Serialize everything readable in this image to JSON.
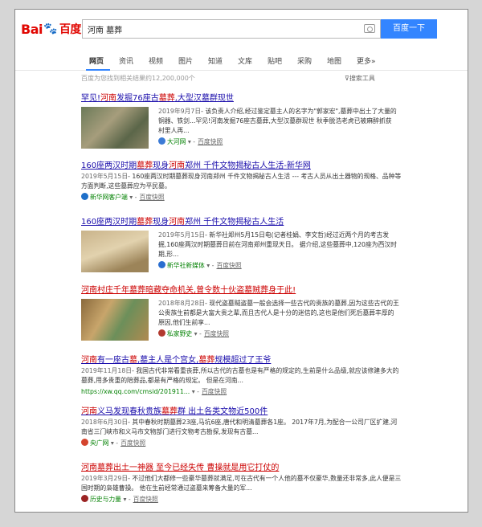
{
  "header": {
    "logo_text": {
      "bai": "Bai",
      "du": "du",
      "cn": "百度"
    },
    "search_value": "河南 墓葬",
    "search_button": "百度一下"
  },
  "tabs": [
    "网页",
    "资讯",
    "视频",
    "图片",
    "知道",
    "文库",
    "贴吧",
    "采购",
    "地图",
    "更多»"
  ],
  "stats": "百度为您找到相关结果约12,200,000个",
  "tools": "搜索工具",
  "results": [
    {
      "title_parts": [
        "罕见!",
        "河南",
        "发掘76座古",
        "墓葬",
        ",大型汉墓群现世"
      ],
      "date": "2019年9月7日",
      "body": "- 该负责人介绍,经过鉴定墓主人的名字为\"郭家宏\",墓葬中出土了大量的铜器、铁剑...罕见!河南发掘76座古墓葬,大型汉墓群现世 秋季脱浩老虎已被麻醉抓获 村里人再...",
      "source": "大河网",
      "kuaizhao": "百度快照"
    },
    {
      "title_parts": [
        "160座两汉时期",
        "墓葬",
        "现身",
        "河南",
        "郑州 千件文物揭秘古人生活-新华网"
      ],
      "date": "2019年5月15日",
      "body": "- 160座两汉时期墓葬现身河南郑州 千件文物揭秘古人生活 --- 考古人员从出土器物的规格、品种等方面判断,这些墓葬应为平民墓。",
      "source": "新华网客户端",
      "kuaizhao": "百度快照"
    },
    {
      "title_parts": [
        "160座两汉时期",
        "墓葬",
        "现身",
        "河南",
        "郑州 千件文物揭秘古人生活"
      ],
      "date": "2019年5月15日",
      "body": "- 新华社郑州5月15日电(记者桂娟、李文哲)经过近两个月的考古发掘,160座两汉时期墓葬日前在河南郑州重现天日。 据介绍,这些墓葬中,120座为西汉时期,形...",
      "source": "新华社新媒体",
      "kuaizhao": "百度快照"
    },
    {
      "title_parts": [
        "河南",
        "村庄千年",
        "墓葬",
        "暗藏夺命机关,曾令数十伙盗墓贼葬身于此!"
      ],
      "date": "2018年8月28日",
      "body": "- 现代盗墓贼盗墓一般会选择一些古代的贵族的墓葬,因为这些古代的王公贵族生前都是大富大贵之辈,而且古代人是十分的迷信的,这也是他们死后墓葬丰厚的原因,他们生前享...",
      "source": "私家野史",
      "kuaizhao": "百度快照"
    },
    {
      "title_parts": [
        "河南",
        "有一座古",
        "墓",
        ",墓主人是个宫女,",
        "墓葬",
        "规模超过了王爷"
      ],
      "date": "2019年11月18日",
      "body": "- 我国古代非常看重丧葬,所以古代的古墓也是有严格的规定的,生前是什么品级,就应该修建多大的墓葬,用多贵重的陪葬品,都是有严格的规定。 但是在河南...",
      "url": "https://xw.qq.com/cmsid/201911...",
      "kuaizhao": "百度快照"
    },
    {
      "title_parts": [
        "河南",
        "义马发现春秋贵族",
        "墓葬",
        "群 出土各类文物近500件"
      ],
      "date": "2018年6月30日",
      "body": "- 其中春秋时期墓葬23座,马坑6座,唐代和明清墓葬各1座。 2017年7月,为配合一公司厂区扩建,河南省三门峡市和义马市文物部门进行文物考古勘探,发现有古墓...",
      "source": "央广网",
      "kuaizhao": "百度快照"
    },
    {
      "title_parts": [
        "河南",
        "墓葬",
        "出土一神器 至今已经失传 曹操就是用它打仗的"
      ],
      "date": "2019年3月29日",
      "body": "- 不过他们大都修一些豪华墓葬就满足,可在古代有一个人他的墓不仅豪华,数量还非常多,此人便是三国时期的枭雄曹操。 他在生前经常通过盗墓来筹备大量的军...",
      "source": "历史与力量",
      "kuaizhao": "百度快照"
    }
  ]
}
